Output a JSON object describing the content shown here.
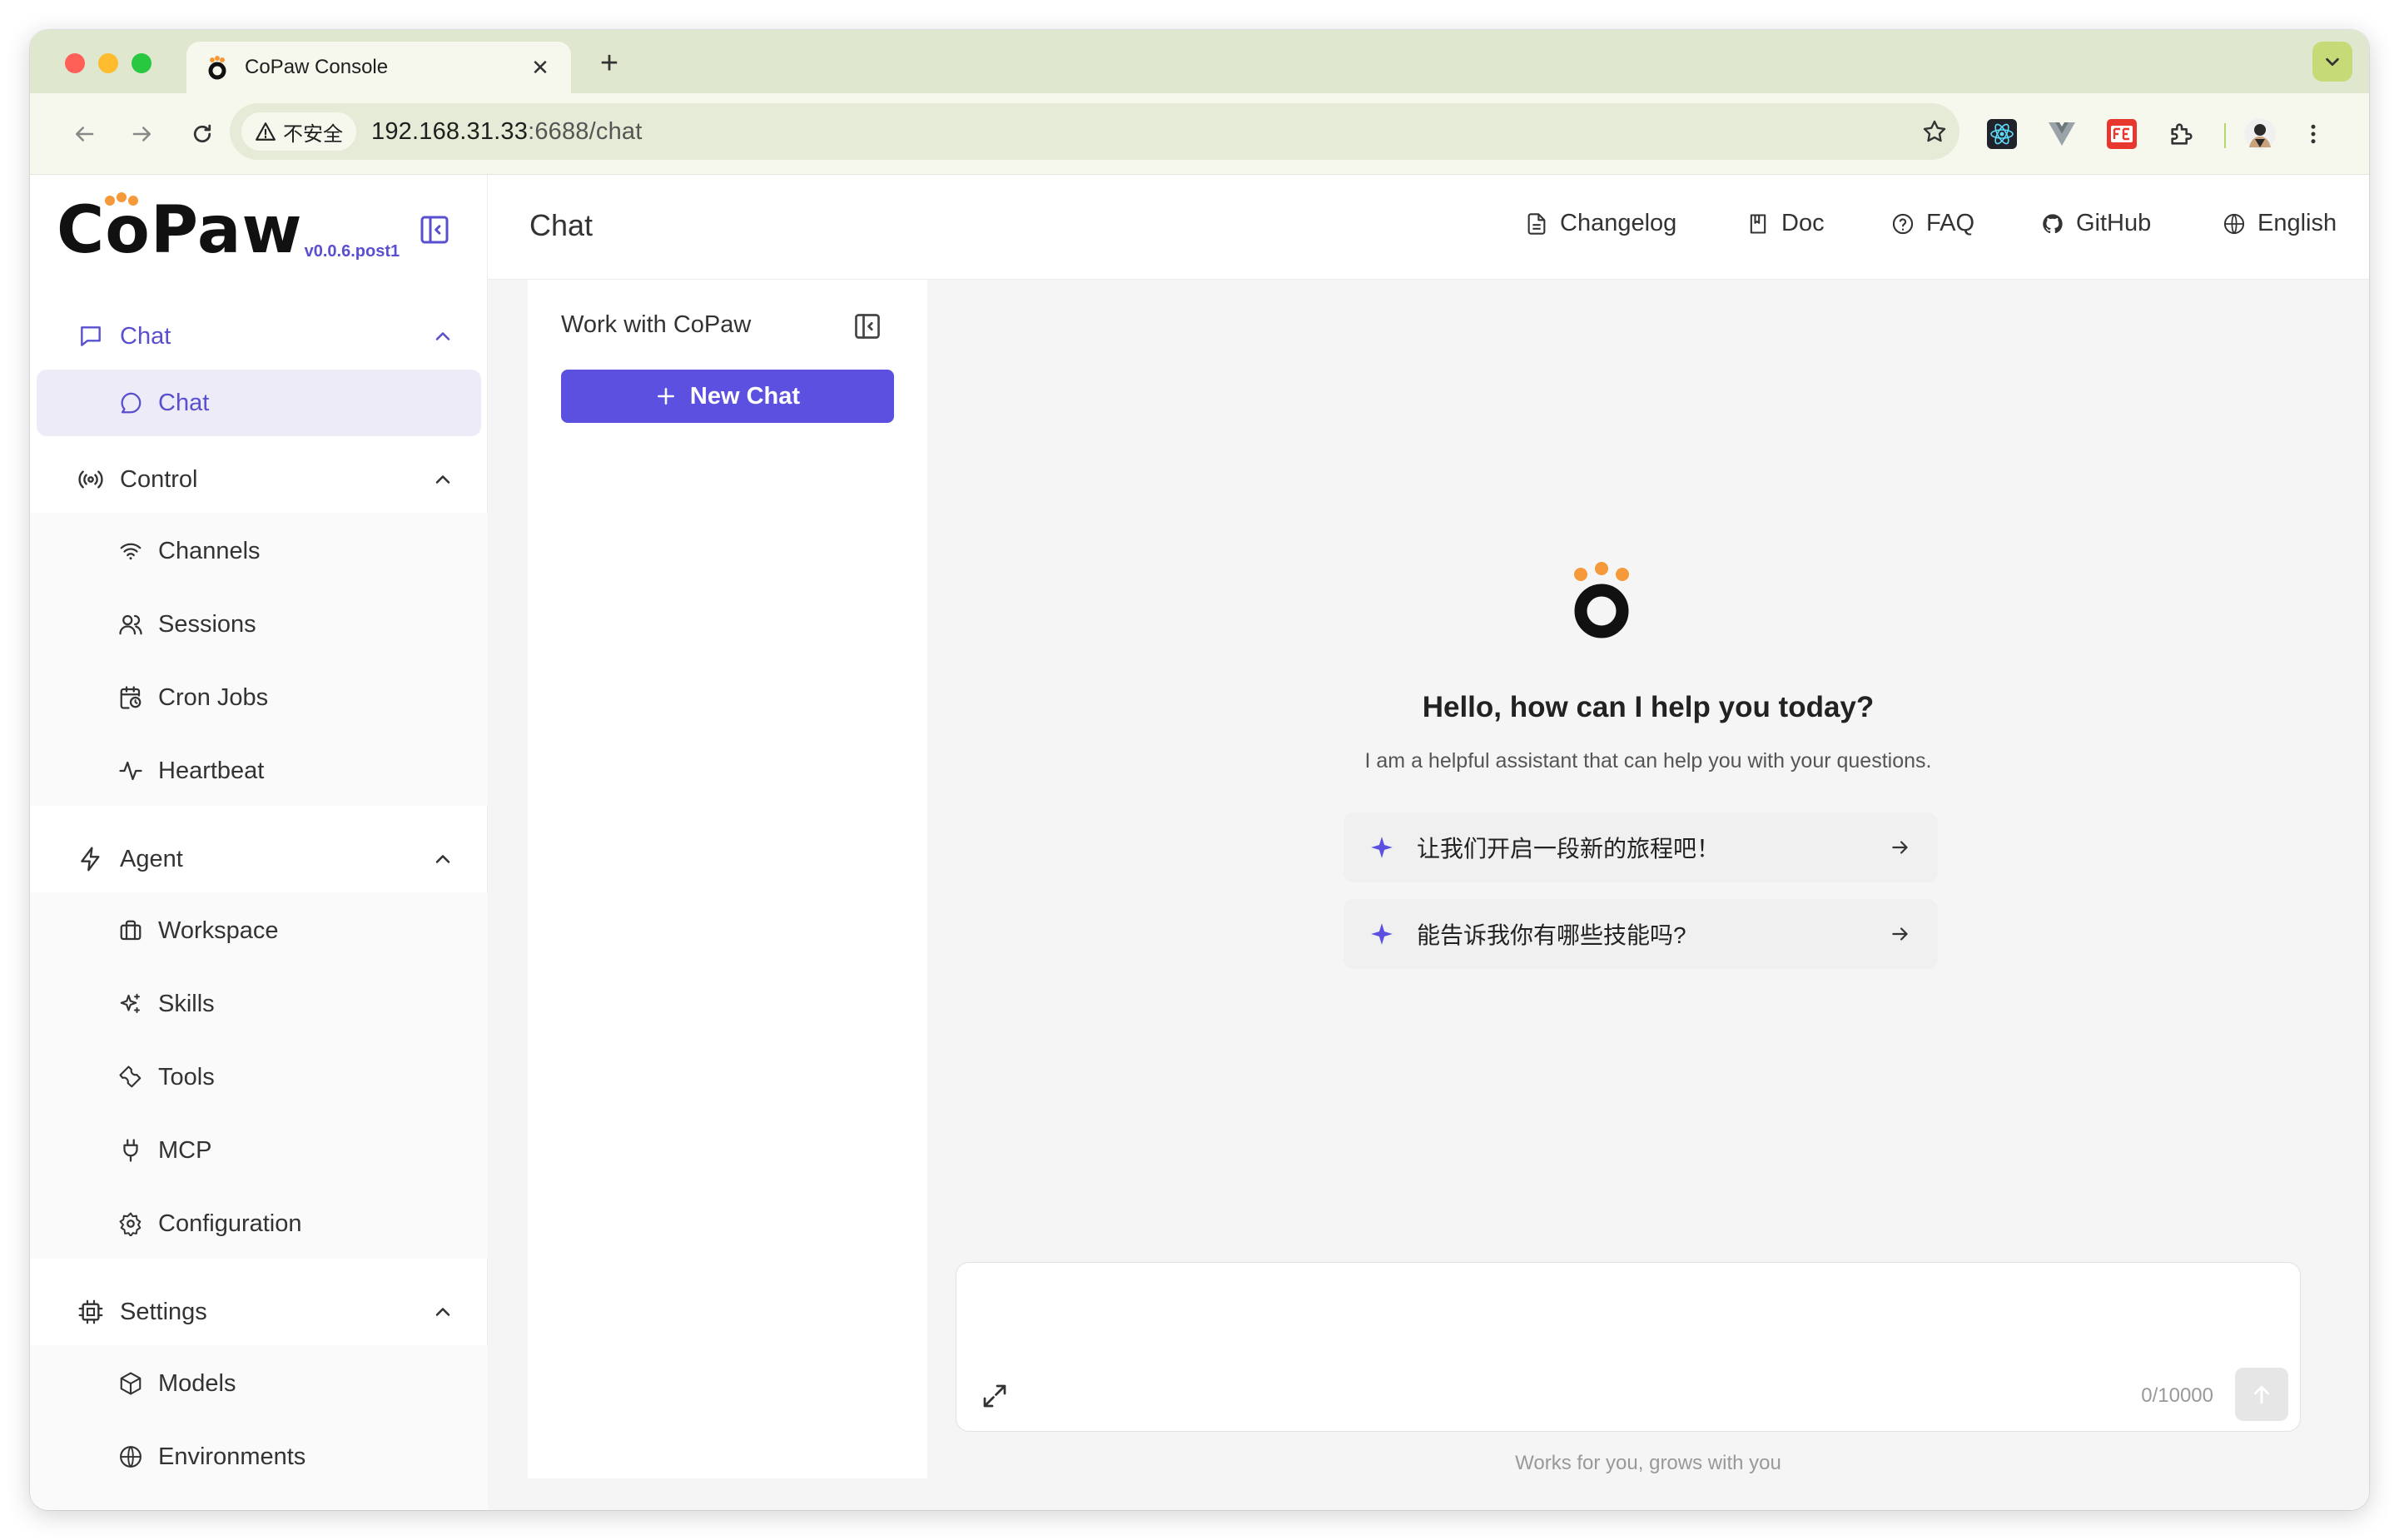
{
  "browser": {
    "tab_title": "CoPaw Console",
    "new_tab": "+",
    "tab_close": "✕",
    "security_label": "不安全",
    "url_host": "192.168.31.33",
    "url_path": ":6688/chat"
  },
  "sidebar": {
    "logo": "CoPaw",
    "version": "v0.0.6.post1",
    "groups": [
      {
        "label": "Chat",
        "icon": "message-square-icon",
        "items": [
          {
            "label": "Chat",
            "icon": "message-circle-icon"
          }
        ]
      },
      {
        "label": "Control",
        "icon": "broadcast-icon",
        "items": [
          {
            "label": "Channels",
            "icon": "wifi-icon"
          },
          {
            "label": "Sessions",
            "icon": "users-icon"
          },
          {
            "label": "Cron Jobs",
            "icon": "calendar-clock-icon"
          },
          {
            "label": "Heartbeat",
            "icon": "activity-icon"
          }
        ]
      },
      {
        "label": "Agent",
        "icon": "zap-icon",
        "items": [
          {
            "label": "Workspace",
            "icon": "briefcase-icon"
          },
          {
            "label": "Skills",
            "icon": "sparkles-icon"
          },
          {
            "label": "Tools",
            "icon": "wrench-icon"
          },
          {
            "label": "MCP",
            "icon": "plug-icon"
          },
          {
            "label": "Configuration",
            "icon": "gear-icon"
          }
        ]
      },
      {
        "label": "Settings",
        "icon": "cpu-icon",
        "items": [
          {
            "label": "Models",
            "icon": "box-icon"
          },
          {
            "label": "Environments",
            "icon": "globe-icon"
          }
        ]
      }
    ]
  },
  "header": {
    "title": "Chat",
    "links": [
      "Changelog",
      "Doc",
      "FAQ",
      "GitHub",
      "English"
    ]
  },
  "sessions": {
    "title": "Work with CoPaw",
    "new_chat": "New Chat"
  },
  "welcome": {
    "title": "Hello, how can I help you today?",
    "subtitle": "I am a helpful assistant that can help you with your questions.",
    "prompts": [
      "让我们开启一段新的旅程吧！",
      "能告诉我你有哪些技能吗?"
    ]
  },
  "composer": {
    "placeholder": "",
    "counter": "0/10000",
    "footer": "Works for you, grows with you"
  },
  "colors": {
    "accent": "#5b50e0",
    "logo_orange": "#f5993a",
    "tabstrip": "#dfe8cf"
  }
}
